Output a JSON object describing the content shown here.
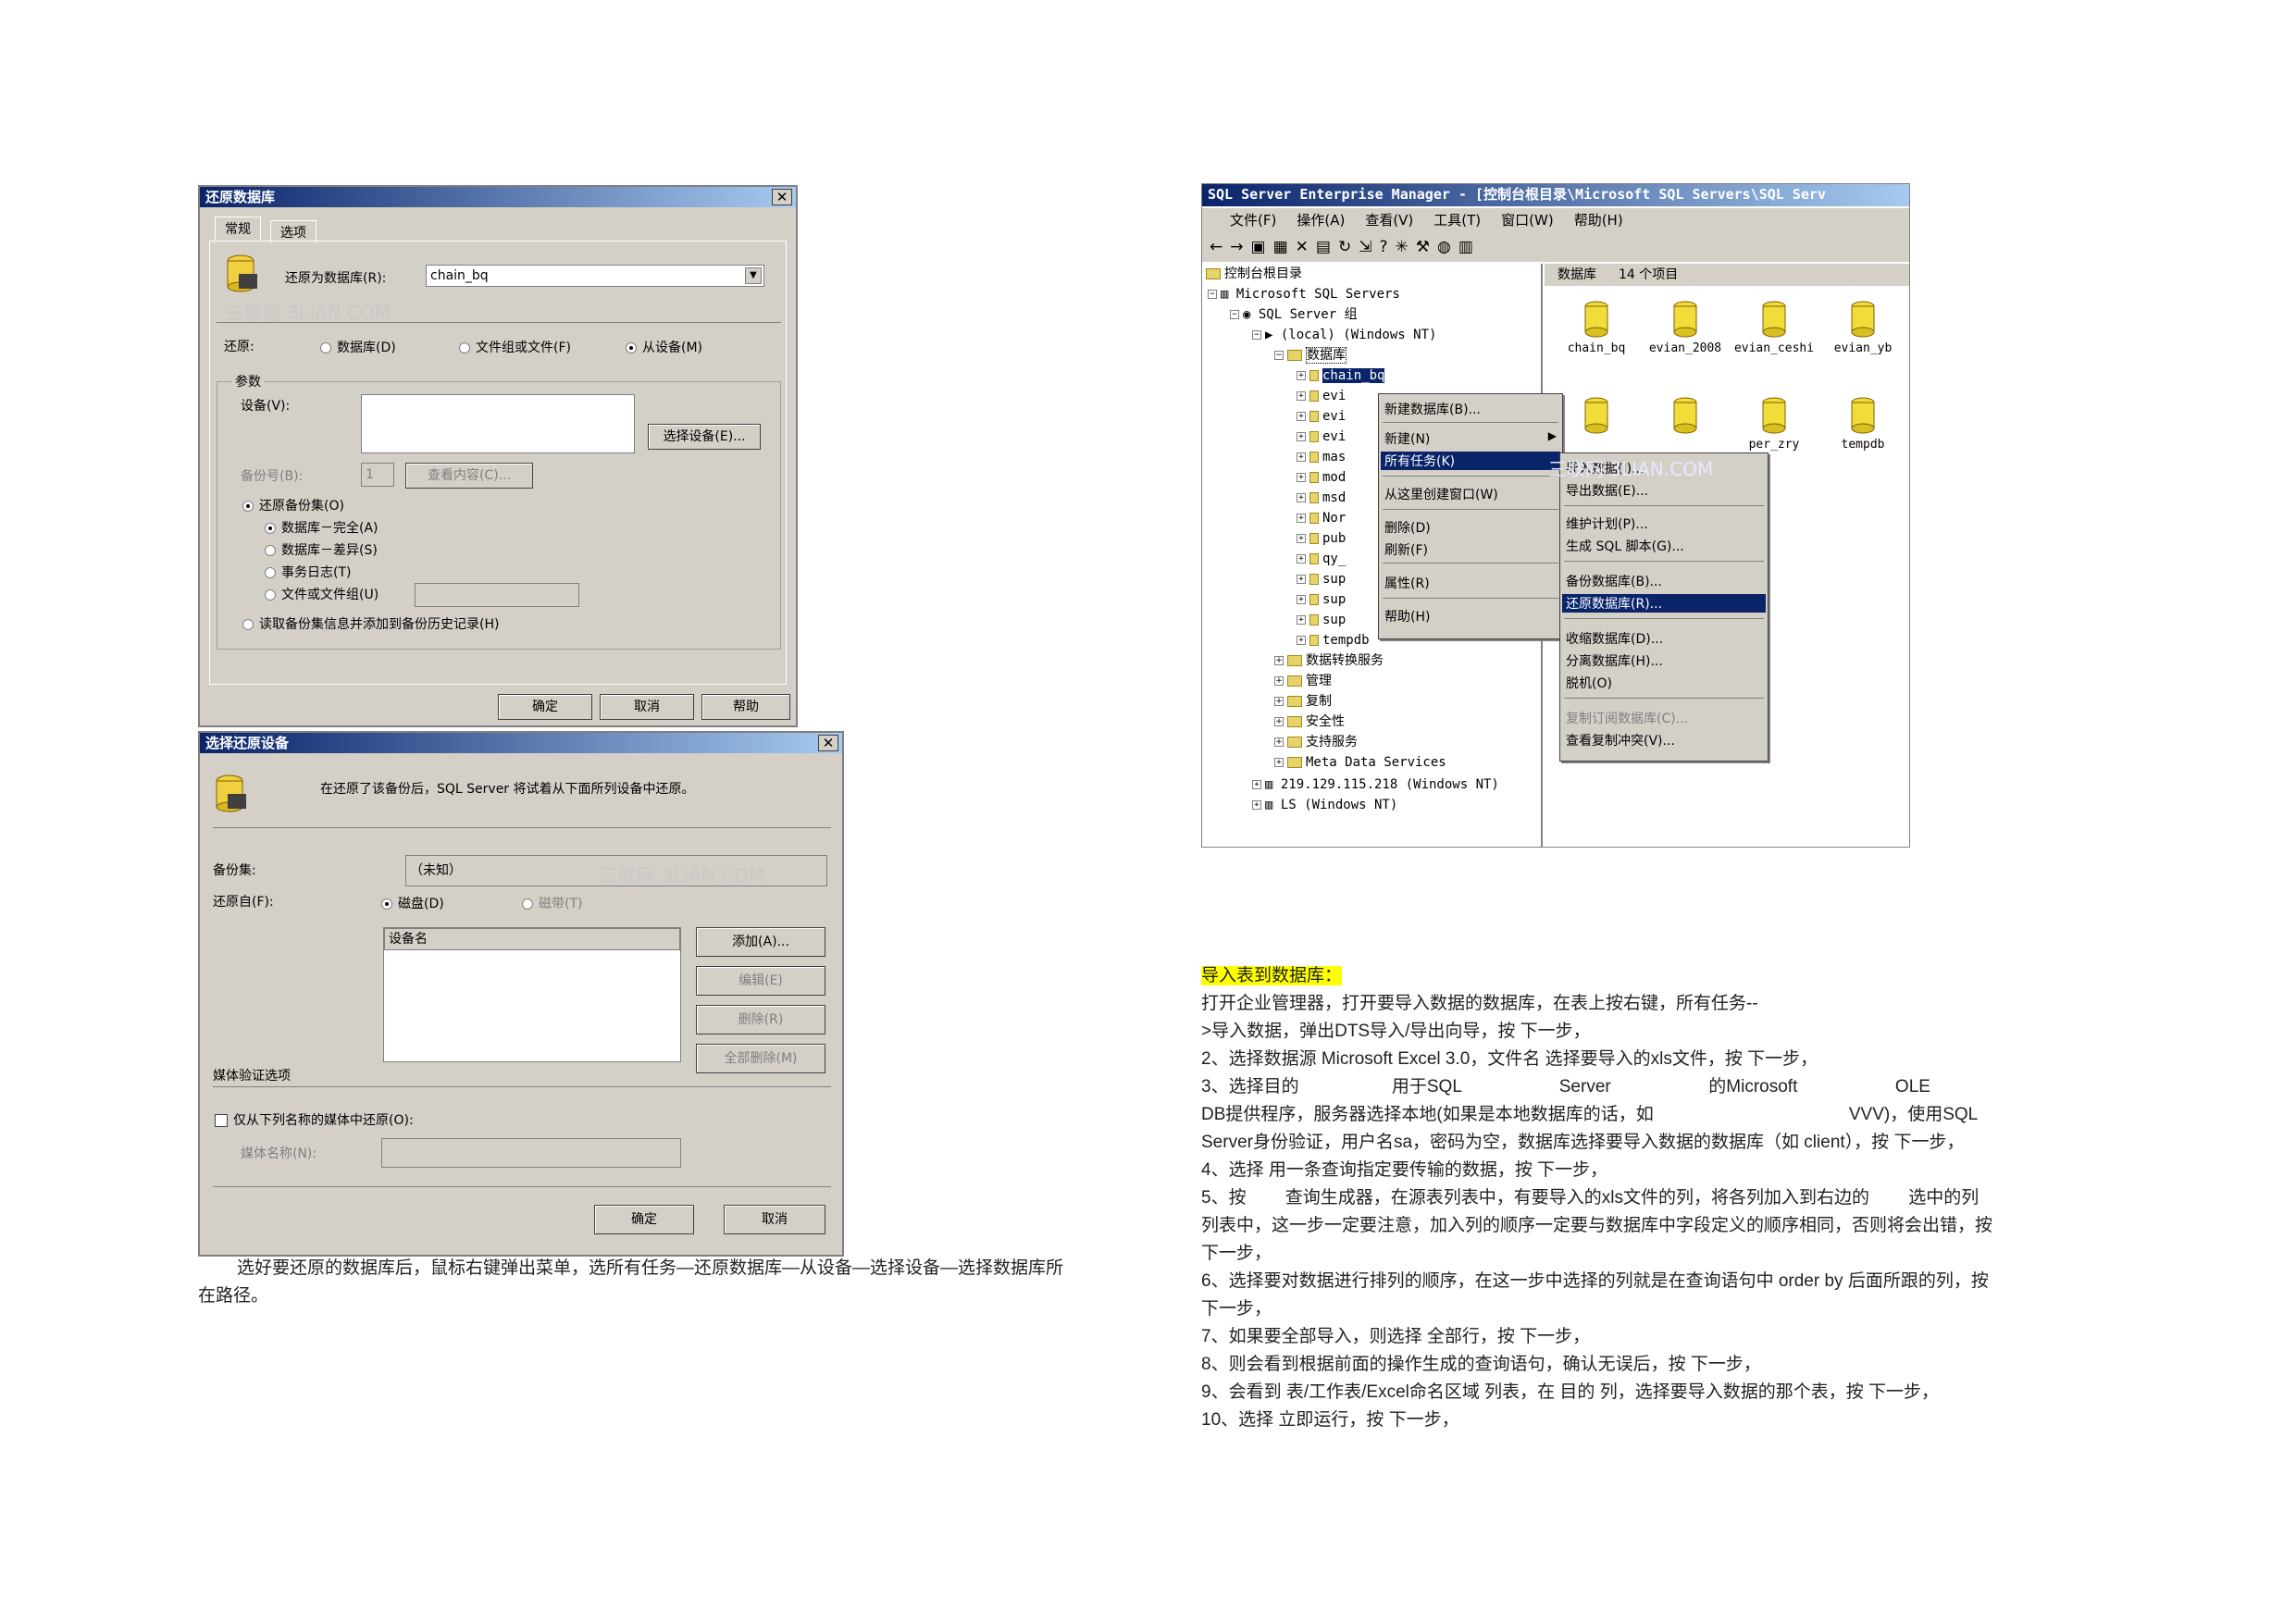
{
  "restore_dialog": {
    "title": "还原数据库",
    "tab_general": "常规",
    "tab_options": "选项",
    "restore_as_label": "还原为数据库(R):",
    "restore_as_value": "chain_bq",
    "restore_label": "还原:",
    "opt_database": "数据库(D)",
    "opt_filegroup": "文件组或文件(F)",
    "opt_device": "从设备(M)",
    "params_label": "参数",
    "devices_label": "设备(V):",
    "select_devices_btn": "选择设备(E)...",
    "backup_no_label": "备份号(B):",
    "backup_no_value": "1",
    "view_contents_btn": "查看内容(C)...",
    "restore_backup_set": "还原备份集(O)",
    "opt_full": "数据库－完全(A)",
    "opt_diff": "数据库－差异(S)",
    "opt_log": "事务日志(T)",
    "opt_file": "文件或文件组(U)",
    "read_backup_info": "读取备份集信息并添加到备份历史记录(H)",
    "ok": "确定",
    "cancel": "取消",
    "help": "帮助",
    "watermark": "三联网 3LIAN.COM"
  },
  "device_dialog": {
    "title": "选择还原设备",
    "message": "在还原了该备份后，SQL Server 将试着从下面所列设备中还原。",
    "backup_set_label": "备份集:",
    "backup_set_value": "（未知）",
    "restore_from_label": "还原自(F):",
    "opt_disk": "磁盘(D)",
    "opt_tape": "磁带(T)",
    "device_name_header": "设备名",
    "add_btn": "添加(A)...",
    "edit_btn": "编辑(E)",
    "remove_btn": "删除(R)",
    "remove_all_btn": "全部删除(M)",
    "media_verify_label": "媒体验证选项",
    "only_from_media": "仅从下列名称的媒体中还原(O):",
    "media_name_label": "媒体名称(N):",
    "ok": "确定",
    "cancel": "取消",
    "watermark": "三联网 3LIAN.COM"
  },
  "caption_left": "选好要还原的数据库后，鼠标右键弹出菜单，选所有任务—还原数据库—从设备—选择设备—选择数据库所在路径。",
  "em": {
    "title": "SQL Server Enterprise Manager - [控制台根目录\\Microsoft SQL Servers\\SQL Serv",
    "menu": [
      "文件(F)",
      "操作(A)",
      "查看(V)",
      "工具(T)",
      "窗口(W)",
      "帮助(H)"
    ],
    "tree": [
      "控制台根目录",
      "Microsoft SQL Servers",
      "SQL Server 组",
      "(local) (Windows NT)",
      "数据库",
      "chain_bq",
      "evi",
      "evi",
      "evi",
      "mas",
      "mod",
      "msd",
      "Nor",
      "pub",
      "qy_",
      "sup",
      "sup",
      "sup",
      "tempdb",
      "数据转换服务",
      "管理",
      "复制",
      "安全性",
      "支持服务",
      "Meta Data Services",
      "219.129.115.218 (Windows NT)",
      "LS (Windows NT)"
    ],
    "list_header": "数据库",
    "list_count": "14 个项目",
    "db_icons": [
      "chain_bq",
      "evian_2008",
      "evian_ceshi",
      "evian_yb",
      "",
      "",
      "per_zry",
      "tempdb"
    ],
    "ctx_menu": [
      "新建数据库(B)...",
      "新建(N)",
      "所有任务(K)",
      "从这里创建窗口(W)",
      "删除(D)",
      "刷新(F)",
      "属性(R)",
      "帮助(H)"
    ],
    "sub_menu": [
      "导入数据(I)...",
      "导出数据(E)...",
      "维护计划(P)...",
      "生成 SQL 脚本(G)...",
      "备份数据库(B)...",
      "还原数据库(R)...",
      "收缩数据库(D)...",
      "分离数据库(H)...",
      "脱机(O)",
      "复制订阅数据库(C)...",
      "查看复制冲突(V)..."
    ],
    "watermark": "三联网 3LIAN.COM"
  },
  "right_text": {
    "heading": "导入表到数据库：",
    "lines": [
      "打开企业管理器，打开要导入数据的数据库，在表上按右键，所有任务--",
      ">导入数据，弹出DTS导入/导出向导，按 下一步，",
      "2、选择数据源 Microsoft Excel 3.0，文件名 选择要导入的xls文件，按 下一步，",
      "3、选择目的                   用于SQL                    Server                    的Microsoft                    OLE",
      "DB提供程序，服务器选择本地(如果是本地数据库的话，如                                        VVV)，使用SQL",
      "Server身份验证，用户名sa，密码为空，数据库选择要导入数据的数据库（如 client），按 下一步，",
      "4、选择 用一条查询指定要传输的数据，按 下一步，",
      "5、按        查询生成器，在源表列表中，有要导入的xls文件的列，将各列加入到右边的        选中的列",
      "列表中，这一步一定要注意，加入列的顺序一定要与数据库中字段定义的顺序相同，否则将会出错，按",
      "下一步，",
      "6、选择要对数据进行排列的顺序，在这一步中选择的列就是在查询语句中 order by 后面所跟的列，按",
      "下一步，",
      "7、如果要全部导入，则选择 全部行，按 下一步，",
      "8、则会看到根据前面的操作生成的查询语句，确认无误后，按 下一步，",
      "9、会看到 表/工作表/Excel命名区域 列表，在 目的 列，选择要导入数据的那个表，按 下一步，",
      "10、选择 立即运行，按 下一步，"
    ]
  }
}
